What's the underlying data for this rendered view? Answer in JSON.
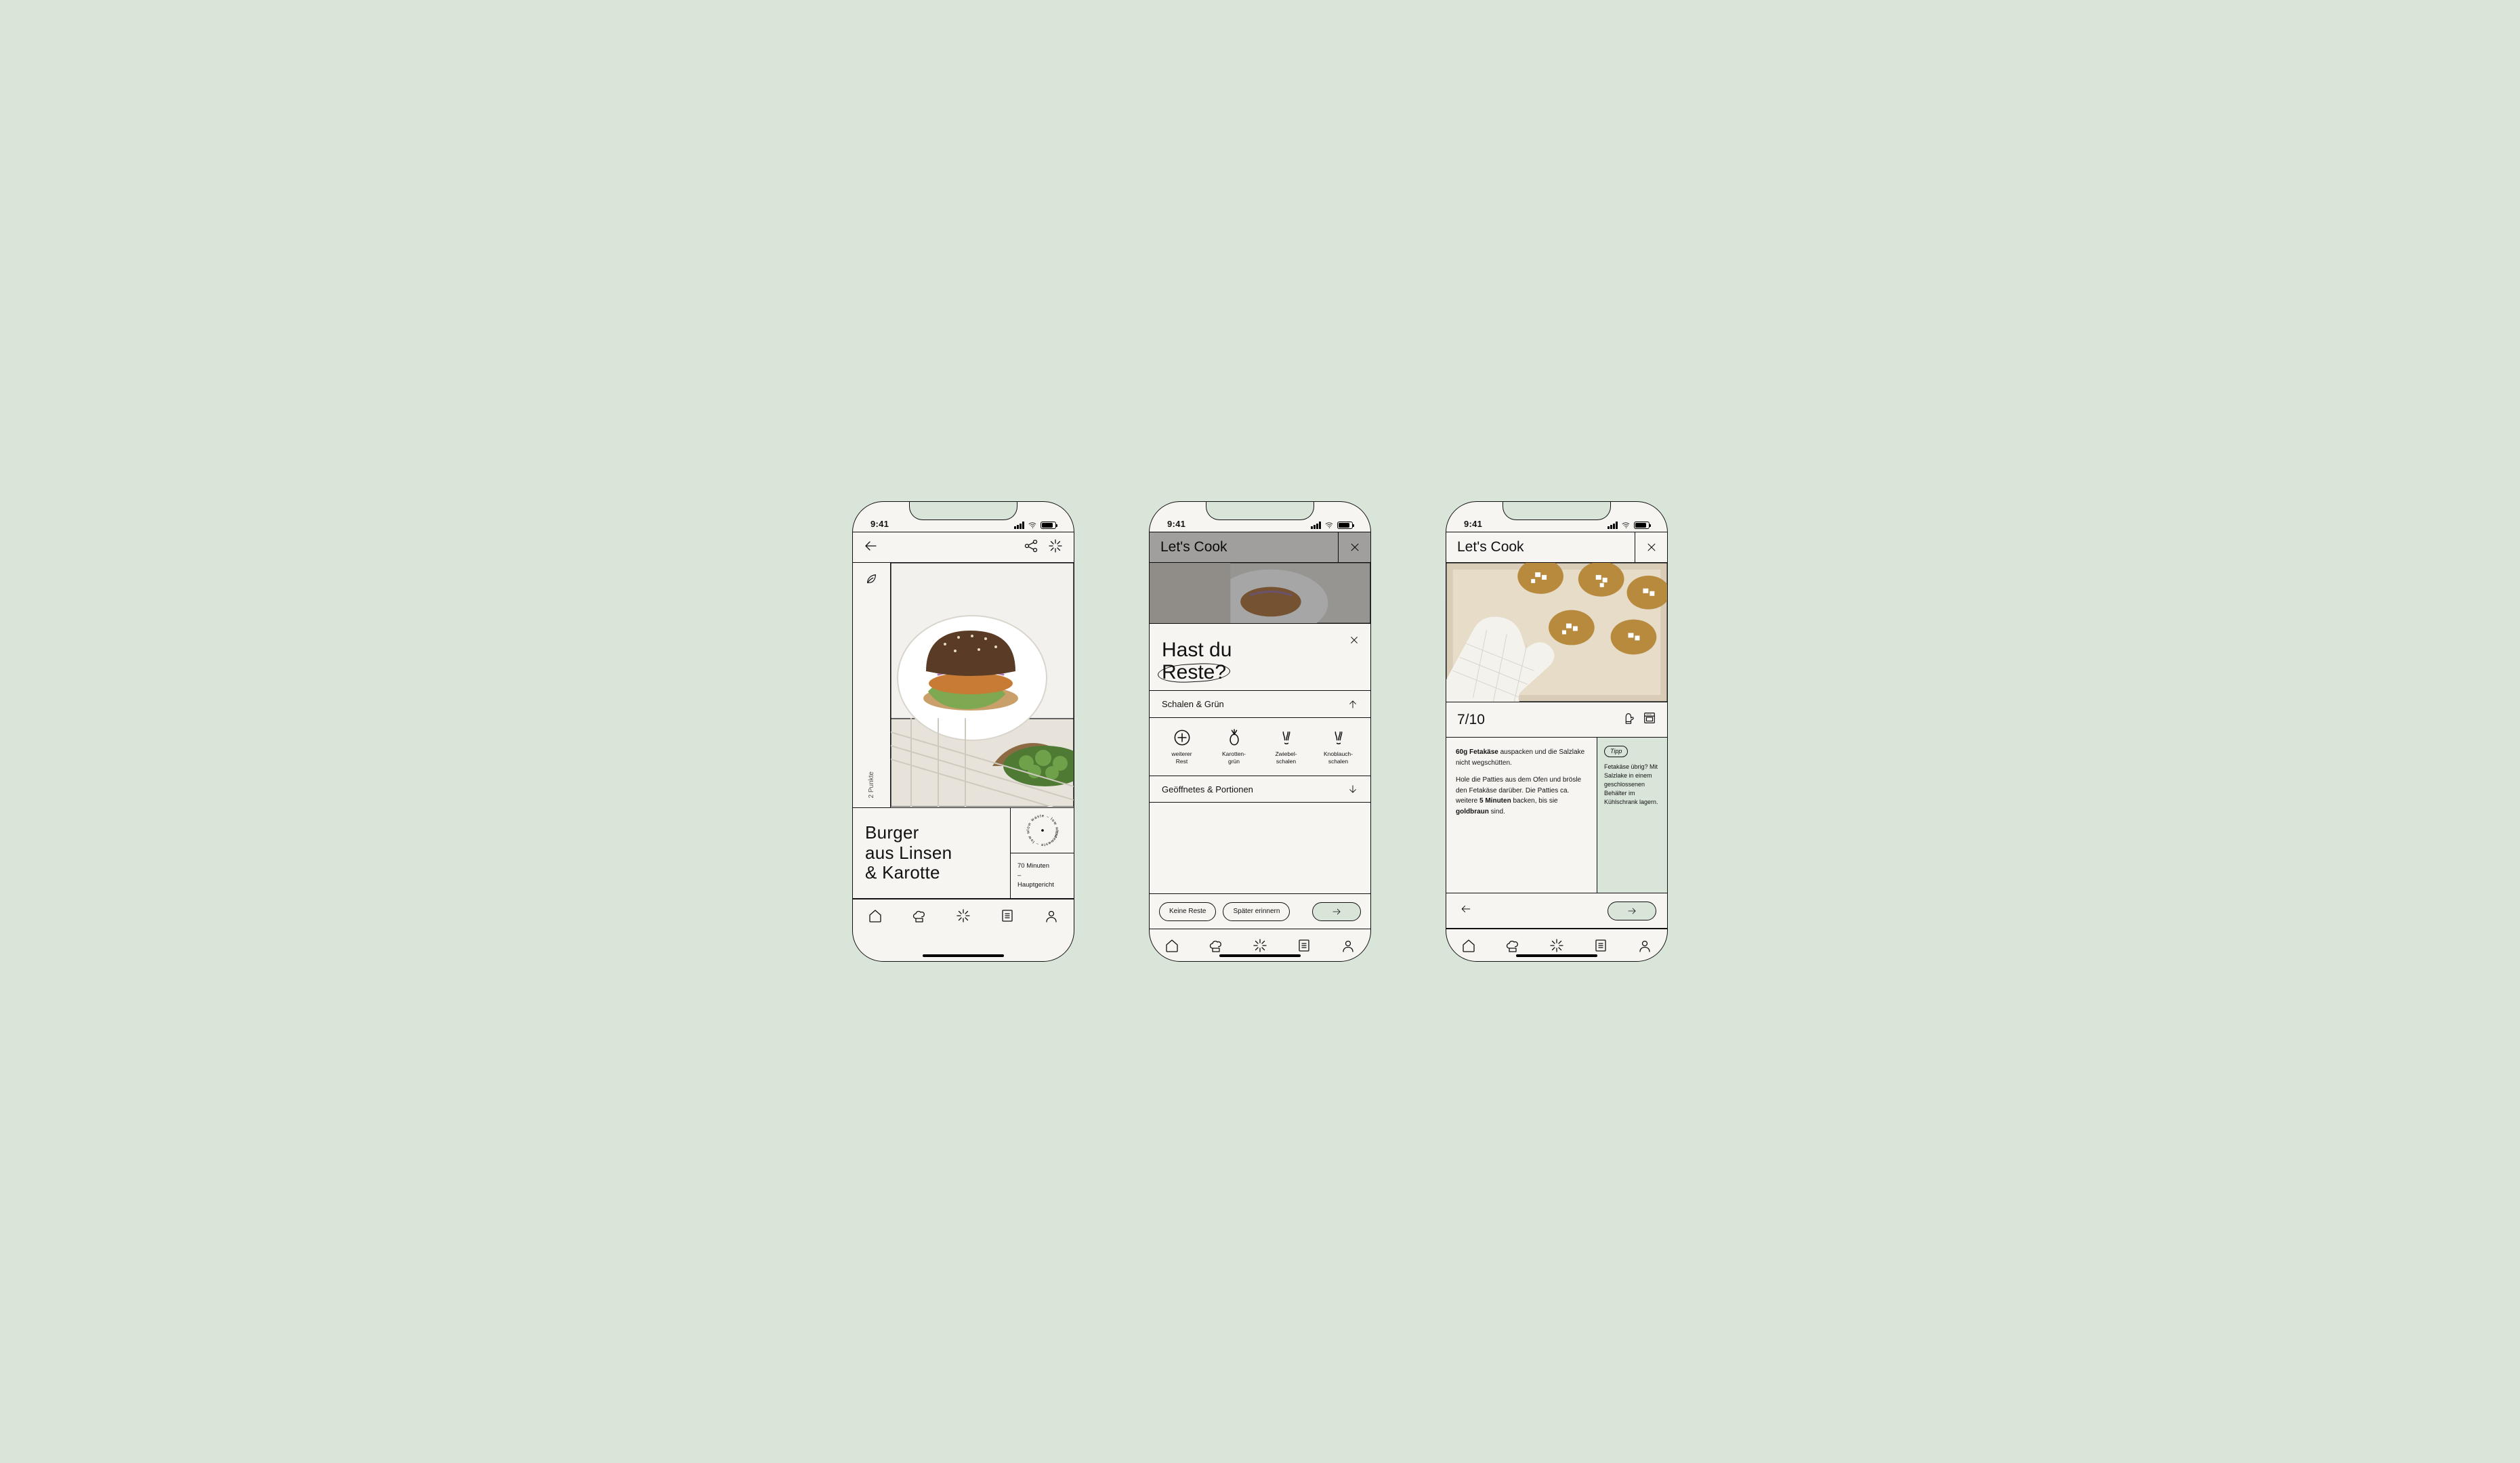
{
  "status": {
    "time": "9:41"
  },
  "nav": {
    "items": [
      "home",
      "chef",
      "spark",
      "list",
      "profile"
    ]
  },
  "phone1": {
    "points": "2 Punkte",
    "title": "Burger\naus Linsen\n& Karotte",
    "stamp_text": "low waste – low waste – ",
    "duration": "70 Minuten",
    "dash": "–",
    "course": "Hauptgericht"
  },
  "phone2": {
    "header_title": "Let's Cook",
    "question_line1": "Hast du",
    "question_line2": "Reste?",
    "acc1": "Schalen & Grün",
    "items": [
      {
        "label1": "weiterer",
        "label2": "Rest"
      },
      {
        "label1": "Karotten-",
        "label2": "grün"
      },
      {
        "label1": "Zwiebel-",
        "label2": "schalen"
      },
      {
        "label1": "Knoblauch-",
        "label2": "schalen"
      }
    ],
    "acc2": "Geöffnetes & Portionen",
    "btn_none": "Keine Reste",
    "btn_later": "Später erinnern"
  },
  "phone3": {
    "header_title": "Let's Cook",
    "step": "7/10",
    "instruction1_strong": "60g Fetakäse",
    "instruction1_rest": " auspacken und die Salzlake nicht wegschütten.",
    "instruction2_a": "Hole die Patties aus dem Ofen und brösle den Fetakäse darüber. Die Patties ca. weitere ",
    "instruction2_b": "5 Minuten",
    "instruction2_c": " backen, bis sie ",
    "instruction2_d": "goldbraun",
    "instruction2_e": " sind.",
    "tip_badge": "Tipp",
    "tip_text": "Fetakäse übrig? Mit Salzlake in einem geschlossenen Behälter im Kühlschrank lagern."
  }
}
